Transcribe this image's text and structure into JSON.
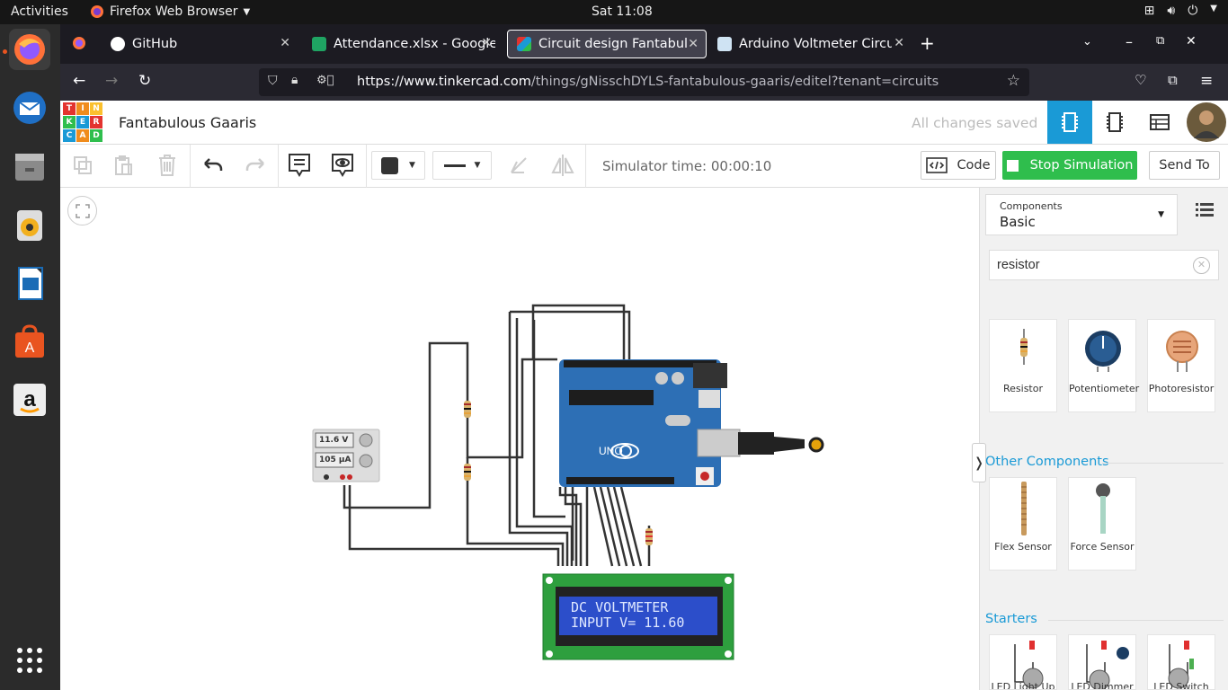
{
  "system": {
    "activities": "Activities",
    "app_name": "Firefox Web Browser",
    "clock": "Sat 11:08"
  },
  "browser": {
    "tabs": [
      {
        "title": "GitHub"
      },
      {
        "title": "Attendance.xlsx - Google"
      },
      {
        "title": "Circuit design Fantabulou"
      },
      {
        "title": "Arduino Voltmeter Circui"
      }
    ],
    "url_domain": "https://www.tinkercad.com",
    "url_path": "/things/gNisschDYLS-fantabulous-gaaris/editel?tenant=circuits"
  },
  "tinkercad": {
    "logo_letters": [
      "T",
      "I",
      "N",
      "K",
      "E",
      "R",
      "C",
      "A",
      "D"
    ],
    "project_title": "Fantabulous Gaaris",
    "save_status": "All changes saved",
    "simulator_time": "Simulator time: 00:00:10",
    "code_label": "Code",
    "stop_label": "Stop Simulation",
    "send_label": "Send To"
  },
  "circuit": {
    "supply_voltage": "11.6 V",
    "supply_current": "105 µA",
    "lcd_line1": "DC VOLTMETER",
    "lcd_line2": "INPUT V= 11.60",
    "arduino_brand": "UNO"
  },
  "panel": {
    "components_label": "Components",
    "components_value": "Basic",
    "search_value": "resistor",
    "basic_items": [
      "Resistor",
      "Potentiometer",
      "Photoresistor"
    ],
    "other_heading": "Other Components",
    "other_items": [
      "Flex Sensor",
      "Force Sensor"
    ],
    "starters_heading": "Starters",
    "starter_items": [
      "LED Light Up",
      "LED Dimmer",
      "LED Switch"
    ]
  },
  "colors": {
    "brand_green": "#2fbe4d",
    "tinkercad_blue": "#1a9ad6",
    "arduino_blue": "#2d6fb5",
    "lcd_green": "#2e9f3e"
  }
}
